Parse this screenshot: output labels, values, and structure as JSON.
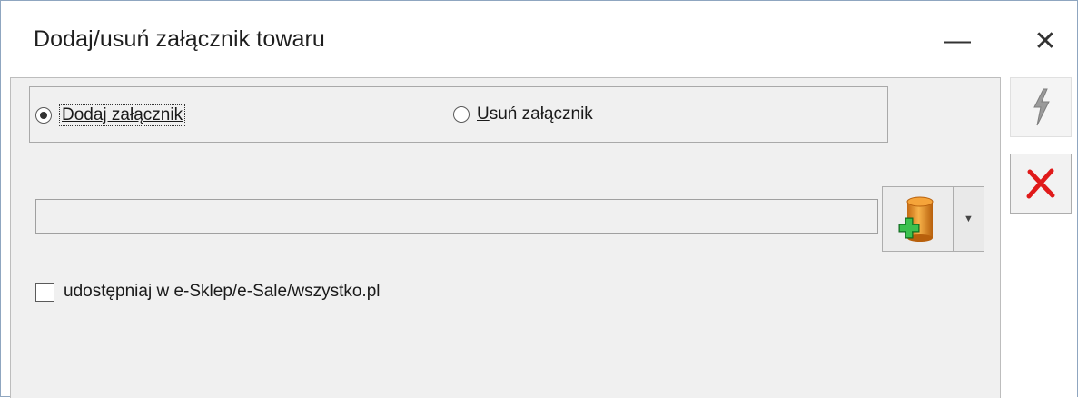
{
  "window": {
    "title": "Dodaj/usuń załącznik towaru",
    "minimize_glyph": "—",
    "close_glyph": "✕"
  },
  "mode": {
    "add_label_hotkey": "D",
    "add_label_rest": "odaj załącznik",
    "remove_label_hotkey": "U",
    "remove_label_rest": "suń załącznik",
    "selected": "add"
  },
  "attachment": {
    "path_value": "",
    "add_icon": "database-add-icon",
    "dropdown_glyph": "▼"
  },
  "share": {
    "label": "udostępniaj w e-Sklep/e-Sale/wszystko.pl",
    "checked": false
  },
  "side_buttons": {
    "run_icon": "lightning-icon",
    "cancel_icon": "red-x-icon"
  },
  "colors": {
    "cancel_red": "#e01a1a",
    "plus_green": "#21a335",
    "db_orange": "#e8912a"
  }
}
